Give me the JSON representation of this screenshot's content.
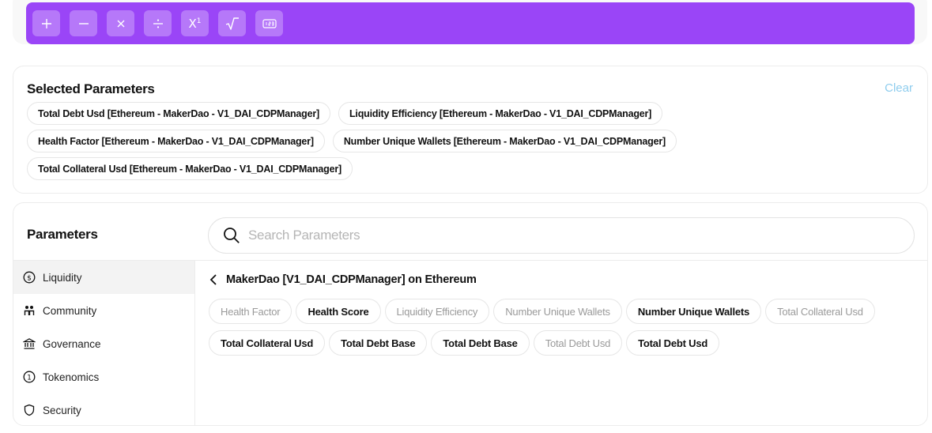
{
  "toolbar": {
    "buttons": [
      {
        "label": "+",
        "icon": "plus-icon"
      },
      {
        "label": "−",
        "icon": "minus-icon"
      },
      {
        "label": "×",
        "icon": "multiply-icon"
      },
      {
        "label": "÷",
        "icon": "divide-icon"
      },
      {
        "label": "X¹",
        "icon": "power-icon"
      },
      {
        "label": "√",
        "icon": "sqrt-icon"
      },
      {
        "label": "",
        "icon": "number-input-icon"
      }
    ],
    "accent": "#9a45f7"
  },
  "selected": {
    "title": "Selected Parameters",
    "clear_label": "Clear",
    "clear_color": "#8fcdee",
    "chips": [
      [
        "Total Debt Usd [Ethereum - MakerDao - V1_DAI_CDPManager]",
        "Liquidity Efficiency [Ethereum - MakerDao - V1_DAI_CDPManager]"
      ],
      [
        "Health Factor [Ethereum - MakerDao - V1_DAI_CDPManager]",
        "Number Unique Wallets [Ethereum - MakerDao - V1_DAI_CDPManager]"
      ],
      [
        "Total Collateral Usd [Ethereum - MakerDao - V1_DAI_CDPManager]"
      ]
    ]
  },
  "parameters": {
    "title": "Parameters",
    "search": {
      "placeholder": "Search Parameters",
      "value": ""
    },
    "sidebar": [
      {
        "label": "Liquidity",
        "icon": "dollar-circle-icon",
        "active": true
      },
      {
        "label": "Community",
        "icon": "people-icon",
        "active": false
      },
      {
        "label": "Governance",
        "icon": "bank-icon",
        "active": false
      },
      {
        "label": "Tokenomics",
        "icon": "one-circle-icon",
        "active": false
      },
      {
        "label": "Security",
        "icon": "shield-icon",
        "active": false
      }
    ],
    "breadcrumb": "MakerDao [V1_DAI_CDPManager] on Ethereum",
    "pills": [
      {
        "label": "Health Factor",
        "enabled": false
      },
      {
        "label": "Health Score",
        "enabled": true
      },
      {
        "label": "Liquidity Efficiency",
        "enabled": false
      },
      {
        "label": "Number Unique Wallets",
        "enabled": false
      },
      {
        "label": "Number Unique Wallets",
        "enabled": true
      },
      {
        "label": "Total Collateral Usd",
        "enabled": false
      },
      {
        "label": "Total Collateral Usd",
        "enabled": true
      },
      {
        "label": "Total Debt Base",
        "enabled": true
      },
      {
        "label": "Total Debt Base",
        "enabled": true
      },
      {
        "label": "Total Debt Usd",
        "enabled": false
      },
      {
        "label": "Total Debt Usd",
        "enabled": true
      }
    ]
  }
}
